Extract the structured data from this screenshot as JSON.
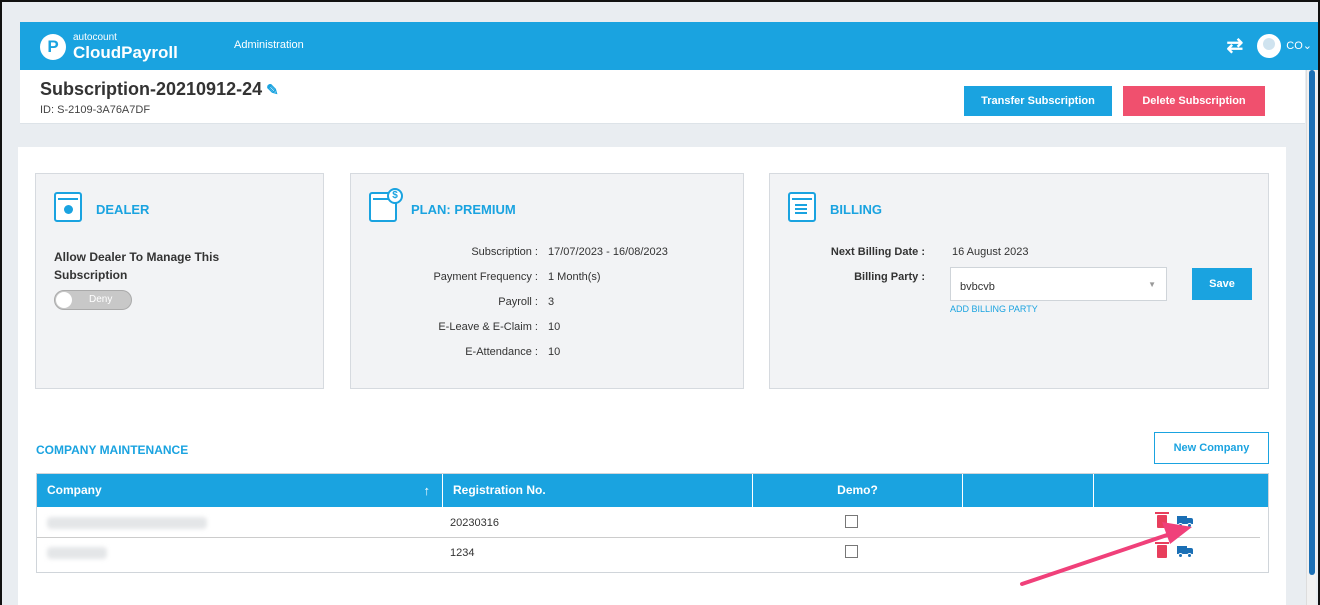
{
  "topbar": {
    "logo_small": "autocount",
    "logo_big": "CloudPayroll",
    "logo_letter": "P",
    "nav_admin": "Administration",
    "user_initials": "CO",
    "user_caret": "⌄"
  },
  "header": {
    "title": "Subscription-20210912-24",
    "id_text": "ID: S-2109-3A76A7DF",
    "transfer_label": "Transfer Subscription",
    "delete_label": "Delete Subscription"
  },
  "dealer": {
    "title": "DEALER",
    "allow_label": "Allow Dealer To Manage This Subscription",
    "toggle_text": "Deny"
  },
  "plan": {
    "title": "PLAN: PREMIUM",
    "rows": [
      {
        "label": "Subscription :",
        "value": "17/07/2023 - 16/08/2023"
      },
      {
        "label": "Payment Frequency :",
        "value": "1 Month(s)"
      },
      {
        "label": "Payroll :",
        "value": "3"
      },
      {
        "label": "E-Leave & E-Claim :",
        "value": "10"
      },
      {
        "label": "E-Attendance :",
        "value": "10"
      }
    ]
  },
  "billing": {
    "title": "BILLING",
    "next_label": "Next Billing Date :",
    "next_value": "16 August 2023",
    "party_label": "Billing Party :",
    "party_value": "bvbcvb",
    "add_party": "ADD BILLING PARTY",
    "save_label": "Save"
  },
  "company": {
    "section_title": "COMPANY MAINTENANCE",
    "new_company_label": "New Company",
    "columns": [
      "Company",
      "Registration No.",
      "Demo?",
      "",
      ""
    ],
    "sort_icon": "↑",
    "rows": [
      {
        "registration": "20230316",
        "demo": false
      },
      {
        "registration": "1234",
        "demo": false
      }
    ]
  },
  "colors": {
    "accent": "#1aa3e0",
    "danger": "#f0506e",
    "annotation_arrow": "#f0407a"
  }
}
